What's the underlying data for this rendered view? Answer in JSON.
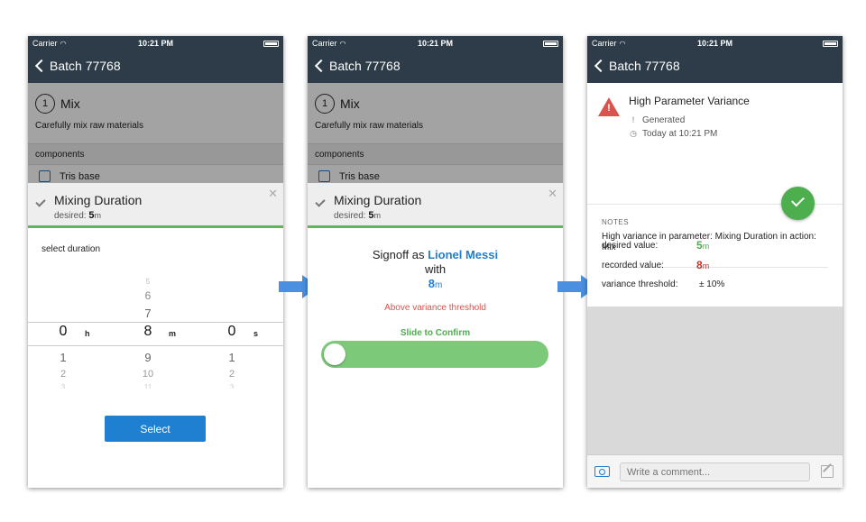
{
  "status": {
    "carrier": "Carrier",
    "time": "10:21 PM"
  },
  "nav": {
    "back_label": "Batch 77768"
  },
  "step": {
    "number": "1",
    "title": "Mix",
    "description": "Carefully mix raw materials"
  },
  "components": {
    "header": "components",
    "first_item": "Tris base"
  },
  "card": {
    "title": "Mixing Duration",
    "desired_label": "desired:",
    "desired_value": "5",
    "desired_unit": "m",
    "close": "✕"
  },
  "picker": {
    "prompt": "select duration",
    "hours": {
      "above": [
        "",
        "",
        ""
      ],
      "selected": "0",
      "below": [
        "1",
        "2",
        "3"
      ],
      "unit": "h"
    },
    "minutes": {
      "above": [
        "5",
        "6",
        "7"
      ],
      "selected": "8",
      "below": [
        "9",
        "10",
        "11"
      ],
      "unit": "m"
    },
    "seconds": {
      "above": [
        "",
        "",
        ""
      ],
      "selected": "0",
      "below": [
        "1",
        "2",
        "3"
      ],
      "unit": "s"
    },
    "button": "Select"
  },
  "signoff": {
    "prefix": "Signoff as",
    "name": "Lionel Messi",
    "with": "with",
    "value": "8",
    "unit": "m",
    "warning": "Above variance threshold",
    "slide_label": "Slide to Confirm"
  },
  "alert": {
    "title": "High Parameter Variance",
    "generated": "Generated",
    "timestamp": "Today at 10:21 PM",
    "notes_label": "NOTES",
    "notes_text": "High variance in parameter: Mixing Duration in action: Mix",
    "desired_label": "desired value:",
    "desired_value": "5",
    "desired_unit": "m",
    "recorded_label": "recorded value:",
    "recorded_value": "8",
    "recorded_unit": "m",
    "threshold_label": "variance threshold:",
    "threshold_value": "± 10%"
  },
  "comment": {
    "placeholder": "Write a comment..."
  },
  "colors": {
    "navbar": "#2d3c48",
    "accent_blue": "#1f7fd0",
    "success": "#4cae4c",
    "danger": "#d9534f",
    "arrow": "#4a8fe0"
  }
}
